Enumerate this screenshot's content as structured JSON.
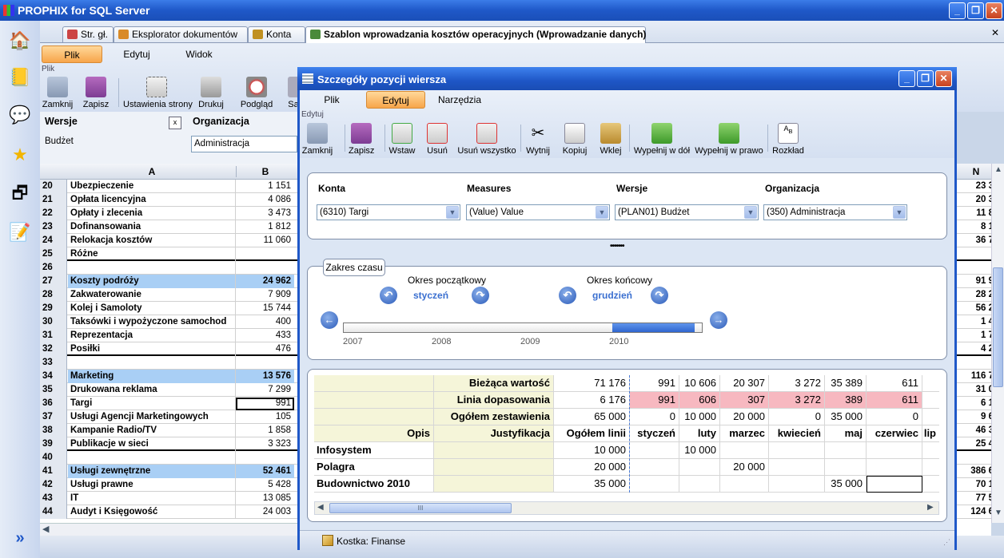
{
  "app": {
    "title": "PROPHIX for SQL Server"
  },
  "doc_tabs": [
    "Str. gł.",
    "Eksplorator dokumentów",
    "Konta",
    "Szablon wprowadzania kosztów operacyjnych (Wprowadzanie danych)"
  ],
  "main_menu": {
    "items": [
      "Plik",
      "Edytuj",
      "Widok"
    ],
    "group": "Plik"
  },
  "main_toolbar": [
    "Zamknij",
    "Zapisz",
    "Ustawienia strony",
    "Drukuj",
    "Podgląd",
    "Sa"
  ],
  "filters": {
    "wersje_label": "Wersje",
    "organizacja_label": "Organizacja",
    "budzet": "Budżet",
    "organizacja_value": "Administracja",
    "x": "x"
  },
  "sheet": {
    "col_a": "A",
    "col_b": "B",
    "col_n": "N",
    "rows": [
      {
        "n": "20",
        "a": "Ubezpieczenie",
        "b": "1 151",
        "nv": "23 3"
      },
      {
        "n": "21",
        "a": "Opłata licencyjna",
        "b": "4 086",
        "nv": "20 3"
      },
      {
        "n": "22",
        "a": "Opłaty i zlecenia",
        "b": "3 473",
        "nv": "11 8"
      },
      {
        "n": "23",
        "a": "Dofinansowania",
        "b": "1 812",
        "nv": "8 1"
      },
      {
        "n": "24",
        "a": "Relokacja kosztów",
        "b": "11 060",
        "nv": "36 7"
      },
      {
        "n": "25",
        "a": "Różne",
        "b": "",
        "nv": ""
      },
      {
        "n": "26",
        "a": "",
        "b": "",
        "nv": ""
      },
      {
        "n": "27",
        "a": "Koszty podróży",
        "b": "24 962",
        "nv": "91 9"
      },
      {
        "n": "28",
        "a": "Zakwaterowanie",
        "b": "7 909",
        "nv": "28 2"
      },
      {
        "n": "29",
        "a": "Kolej i Samoloty",
        "b": "15 744",
        "nv": "56 2"
      },
      {
        "n": "30",
        "a": "Taksówki i wypożyczone samochod",
        "b": "400",
        "nv": "1 4"
      },
      {
        "n": "31",
        "a": "Reprezentacja",
        "b": "433",
        "nv": "1 7"
      },
      {
        "n": "32",
        "a": "Posiłki",
        "b": "476",
        "nv": "4 2"
      },
      {
        "n": "33",
        "a": "",
        "b": "",
        "nv": ""
      },
      {
        "n": "34",
        "a": "Marketing",
        "b": "13 576",
        "nv": "116 7"
      },
      {
        "n": "35",
        "a": "Drukowana reklama",
        "b": "7 299",
        "nv": "31 0"
      },
      {
        "n": "36",
        "a": "Targi",
        "b": "991",
        "nv": "6 1"
      },
      {
        "n": "37",
        "a": "Usługi Agencji Marketingowych",
        "b": "105",
        "nv": "9 6"
      },
      {
        "n": "38",
        "a": "Kampanie Radio/TV",
        "b": "1 858",
        "nv": "46 3"
      },
      {
        "n": "39",
        "a": "Publikacje w sieci",
        "b": "3 323",
        "nv": "25 4"
      },
      {
        "n": "40",
        "a": "",
        "b": "",
        "nv": ""
      },
      {
        "n": "41",
        "a": "Usługi zewnętrzne",
        "b": "52 461",
        "nv": "386 6"
      },
      {
        "n": "42",
        "a": "Usługi prawne",
        "b": "5 428",
        "nv": "70 1"
      },
      {
        "n": "43",
        "a": "IT",
        "b": "13 085",
        "nv": "77 5"
      },
      {
        "n": "44",
        "a": "Audyt i Księgowość",
        "b": "24 003",
        "nv": "124 6"
      }
    ]
  },
  "dialog": {
    "title": "Szczegóły pozycji wiersza",
    "menu": [
      "Plik",
      "Edytuj",
      "Narzędzia"
    ],
    "group": "Edytuj",
    "toolbar": [
      "Zamknij",
      "Zapisz",
      "Wstaw",
      "Usuń",
      "Usuń wszystko",
      "Wytnij",
      "Kopiuj",
      "Wklej",
      "Wypełnij w dół",
      "Wypełnij w prawo",
      "Rozkład"
    ],
    "dims": [
      {
        "label": "Konta",
        "value": "(6310) Targi"
      },
      {
        "label": "Measures",
        "value": "(Value) Value"
      },
      {
        "label": "Wersje",
        "value": "(PLAN01) Budżet"
      },
      {
        "label": "Organizacja",
        "value": "(350) Administracja"
      }
    ],
    "splitter": "•••••••",
    "time": {
      "legend": "Zakres czasu",
      "start_label": "Okres początkowy",
      "start_value": "styczeń",
      "end_label": "Okres końcowy",
      "end_value": "grudzień",
      "years": [
        "2007",
        "2008",
        "2009",
        "2010"
      ],
      "range_start_fraction": 0.75,
      "range_end_fraction": 0.98
    },
    "grid": {
      "summary": [
        {
          "label": "Bieżąca wartość",
          "vals": [
            "71 176",
            "991",
            "10 606",
            "20 307",
            "3 272",
            "35 389",
            "611"
          ]
        },
        {
          "label": "Linia dopasowania",
          "vals": [
            "6 176",
            "991",
            "606",
            "307",
            "3 272",
            "389",
            "611"
          ]
        },
        {
          "label": "Ogółem zestawienia",
          "vals": [
            "65 000",
            "0",
            "10 000",
            "20 000",
            "0",
            "35 000",
            "0"
          ]
        }
      ],
      "headers": [
        "Opis",
        "Justyfikacja",
        "Ogółem linii",
        "styczeń",
        "luty",
        "marzec",
        "kwiecień",
        "maj",
        "czerwiec",
        "lip"
      ],
      "rows": [
        {
          "opis": "Infosystem",
          "vals": [
            "10 000",
            "",
            "10 000",
            "",
            "",
            "",
            ""
          ]
        },
        {
          "opis": "Polagra",
          "vals": [
            "20 000",
            "",
            "",
            "20 000",
            "",
            "",
            ""
          ]
        },
        {
          "opis": "Budownictwo 2010",
          "vals": [
            "35 000",
            "",
            "",
            "",
            "",
            "35 000",
            ""
          ]
        }
      ],
      "scroll_mark": "III"
    },
    "status": "Kostka: Finanse"
  }
}
